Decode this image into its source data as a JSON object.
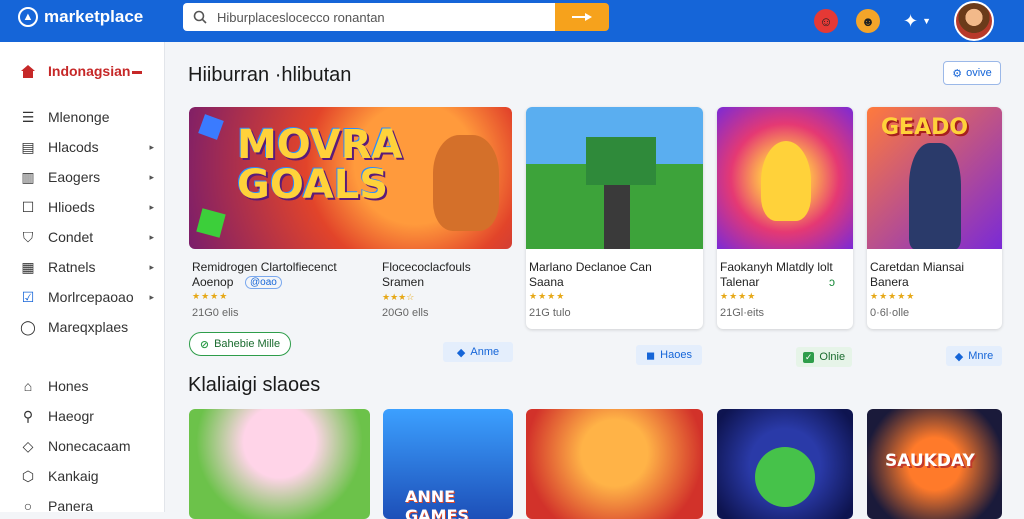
{
  "header": {
    "brand": "marketplace",
    "search_value": "Hiburplaceslocecco ronantan"
  },
  "sidebar": {
    "head": "Indonagsian",
    "items": [
      {
        "label": "Mlenonge",
        "icon": "list-icon",
        "chevron": false
      },
      {
        "label": "Hlacods",
        "icon": "document-icon",
        "chevron": true
      },
      {
        "label": "Eaogers",
        "icon": "store-icon",
        "chevron": true
      },
      {
        "label": "Hlioeds",
        "icon": "square-icon",
        "chevron": true
      },
      {
        "label": "Condet",
        "icon": "shield-icon",
        "chevron": true
      },
      {
        "label": "Ratnels",
        "icon": "calendar-icon",
        "chevron": true
      },
      {
        "label": "Morlrcepaoao",
        "icon": "check-icon",
        "chevron": true
      },
      {
        "label": "Mareqxplaes",
        "icon": "circle-icon",
        "chevron": false
      },
      {
        "label": "Hones",
        "icon": "home-icon",
        "chevron": false
      },
      {
        "label": "Haeogr",
        "icon": "search-icon",
        "chevron": false
      },
      {
        "label": "Nonecacaam",
        "icon": "tag-icon",
        "chevron": false
      },
      {
        "label": "Kankaig",
        "icon": "cart-icon",
        "chevron": false
      },
      {
        "label": "Panera",
        "icon": "user-icon",
        "chevron": false
      }
    ]
  },
  "section1": {
    "title": "Hiiburran ·hlibutan",
    "view_label": "ovive",
    "cards": [
      {
        "art_title": "MOVRA GOALS",
        "name": "Remidrogen Clartolfiecenct\nAoenop",
        "badge": "@oao",
        "count": "21G0 elis",
        "rating": 4
      },
      {
        "art_title": "",
        "name": "Flocecoclacfouls\nSramen",
        "badge": "",
        "count": "20G0 ells",
        "rating": 3.5
      },
      {
        "art_title": "",
        "name": "Marlano Declanoe Can\nSaana",
        "badge": "",
        "count": "21G tulo",
        "rating": 4
      },
      {
        "art_title": "",
        "name": "Faokanyh Mlatdly lolt\nTalenar",
        "badge": "",
        "count": "21Gl·eits",
        "rating": 4,
        "extra": "ɔ"
      },
      {
        "art_title": "GEADO",
        "name": "Caretdan Miansai\nBanera",
        "badge": "",
        "count": "0·6l·olle",
        "rating": 4.5
      }
    ],
    "pills": [
      {
        "label": "Bahebie Mille",
        "icon": "circle-icon"
      },
      {
        "label": "Anme",
        "icon": "pin-icon"
      },
      {
        "label": "Haoes",
        "icon": "flag-icon"
      },
      {
        "label": "Olnie",
        "icon": "check-icon"
      },
      {
        "label": "Mnre",
        "icon": "tag-icon"
      }
    ]
  },
  "section2": {
    "title": "Klaliaigi slaoes",
    "tiles": [
      {
        "art_title": ""
      },
      {
        "art_title": "ANNE GAMES"
      },
      {
        "art_title": ""
      },
      {
        "art_title": ""
      },
      {
        "art_title": "SAUKDAY"
      }
    ]
  },
  "colors": {
    "topbar": "#1565d8",
    "search_button": "#f6a21c",
    "sidebar_head": "#c62828",
    "stars": "#e6a817"
  }
}
